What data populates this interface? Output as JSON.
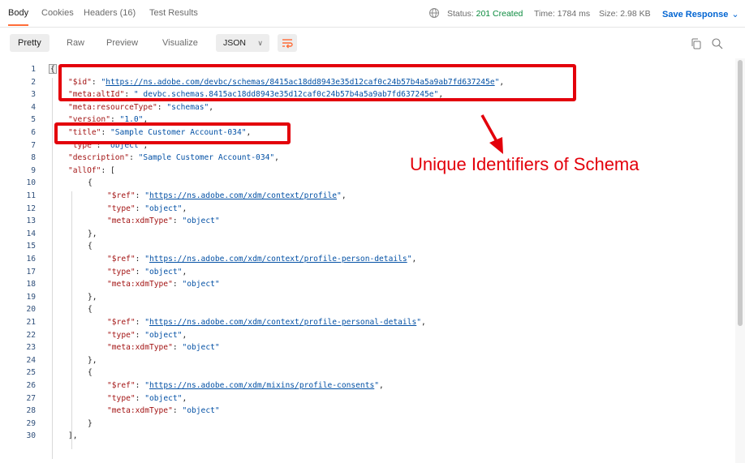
{
  "response_tabs": [
    {
      "label": "Body",
      "active": true
    },
    {
      "label": "Cookies",
      "active": false
    },
    {
      "label": "Headers",
      "count": "(16)",
      "active": false
    },
    {
      "label": "Test Results",
      "active": false
    }
  ],
  "status": {
    "label": "Status:",
    "value": "201 Created"
  },
  "time": {
    "label": "Time:",
    "value": "1784 ms"
  },
  "size": {
    "label": "Size:",
    "value": "2.98 KB"
  },
  "save_response": "Save Response",
  "view_modes": [
    "Pretty",
    "Raw",
    "Preview",
    "Visualize"
  ],
  "active_view_mode": "Pretty",
  "format_select": "JSON",
  "colors": {
    "accent": "#ff6c37",
    "link": "#0265d2",
    "status_ok": "#0b8a3e",
    "annotation": "#e3000b"
  },
  "icons": [
    "globe-icon",
    "chevron-down-icon",
    "wrap-lines-icon",
    "copy-icon",
    "search-icon"
  ],
  "code_lines": [
    {
      "n": "1",
      "indent": 0,
      "tokens": [
        {
          "t": "{",
          "c": "brace"
        }
      ]
    },
    {
      "n": "2",
      "indent": 1,
      "tokens": [
        {
          "t": "\"$id\"",
          "c": "k"
        },
        {
          "t": ": ",
          "c": "p"
        },
        {
          "t": "\"",
          "c": "s"
        },
        {
          "t": "https://ns.adobe.com/devbc/schemas/8415ac18dd8943e35d12caf0c24b57b4a5a9ab7fd637245e",
          "c": "u"
        },
        {
          "t": "\"",
          "c": "s"
        },
        {
          "t": ",",
          "c": "p"
        }
      ]
    },
    {
      "n": "3",
      "indent": 1,
      "tokens": [
        {
          "t": "\"meta:altId\"",
          "c": "k"
        },
        {
          "t": ": ",
          "c": "p"
        },
        {
          "t": "\"_devbc.schemas.8415ac18dd8943e35d12caf0c24b57b4a5a9ab7fd637245e\"",
          "c": "s"
        },
        {
          "t": ",",
          "c": "p"
        }
      ]
    },
    {
      "n": "4",
      "indent": 1,
      "tokens": [
        {
          "t": "\"meta:resourceType\"",
          "c": "k"
        },
        {
          "t": ": ",
          "c": "p"
        },
        {
          "t": "\"schemas\"",
          "c": "s"
        },
        {
          "t": ",",
          "c": "p"
        }
      ]
    },
    {
      "n": "5",
      "indent": 1,
      "tokens": [
        {
          "t": "\"version\"",
          "c": "k"
        },
        {
          "t": ": ",
          "c": "p"
        },
        {
          "t": "\"1.0\"",
          "c": "s"
        },
        {
          "t": ",",
          "c": "p"
        }
      ]
    },
    {
      "n": "6",
      "indent": 1,
      "tokens": [
        {
          "t": "\"title\"",
          "c": "k"
        },
        {
          "t": ": ",
          "c": "p"
        },
        {
          "t": "\"Sample Customer Account-034\"",
          "c": "s"
        },
        {
          "t": ",",
          "c": "p"
        }
      ]
    },
    {
      "n": "7",
      "indent": 1,
      "tokens": [
        {
          "t": "\"type\"",
          "c": "k"
        },
        {
          "t": ": ",
          "c": "p"
        },
        {
          "t": "\"object\"",
          "c": "s"
        },
        {
          "t": ",",
          "c": "p"
        }
      ]
    },
    {
      "n": "8",
      "indent": 1,
      "tokens": [
        {
          "t": "\"description\"",
          "c": "k"
        },
        {
          "t": ": ",
          "c": "p"
        },
        {
          "t": "\"Sample Customer Account-034\"",
          "c": "s"
        },
        {
          "t": ",",
          "c": "p"
        }
      ]
    },
    {
      "n": "9",
      "indent": 1,
      "tokens": [
        {
          "t": "\"allOf\"",
          "c": "k"
        },
        {
          "t": ": [",
          "c": "p"
        }
      ]
    },
    {
      "n": "10",
      "indent": 2,
      "tokens": [
        {
          "t": "{",
          "c": "p"
        }
      ]
    },
    {
      "n": "11",
      "indent": 3,
      "tokens": [
        {
          "t": "\"$ref\"",
          "c": "k"
        },
        {
          "t": ": ",
          "c": "p"
        },
        {
          "t": "\"",
          "c": "s"
        },
        {
          "t": "https://ns.adobe.com/xdm/context/profile",
          "c": "u"
        },
        {
          "t": "\"",
          "c": "s"
        },
        {
          "t": ",",
          "c": "p"
        }
      ]
    },
    {
      "n": "12",
      "indent": 3,
      "tokens": [
        {
          "t": "\"type\"",
          "c": "k"
        },
        {
          "t": ": ",
          "c": "p"
        },
        {
          "t": "\"object\"",
          "c": "s"
        },
        {
          "t": ",",
          "c": "p"
        }
      ]
    },
    {
      "n": "13",
      "indent": 3,
      "tokens": [
        {
          "t": "\"meta:xdmType\"",
          "c": "k"
        },
        {
          "t": ": ",
          "c": "p"
        },
        {
          "t": "\"object\"",
          "c": "s"
        }
      ]
    },
    {
      "n": "14",
      "indent": 2,
      "tokens": [
        {
          "t": "},",
          "c": "p"
        }
      ]
    },
    {
      "n": "15",
      "indent": 2,
      "tokens": [
        {
          "t": "{",
          "c": "p"
        }
      ]
    },
    {
      "n": "16",
      "indent": 3,
      "tokens": [
        {
          "t": "\"$ref\"",
          "c": "k"
        },
        {
          "t": ": ",
          "c": "p"
        },
        {
          "t": "\"",
          "c": "s"
        },
        {
          "t": "https://ns.adobe.com/xdm/context/profile-person-details",
          "c": "u"
        },
        {
          "t": "\"",
          "c": "s"
        },
        {
          "t": ",",
          "c": "p"
        }
      ]
    },
    {
      "n": "17",
      "indent": 3,
      "tokens": [
        {
          "t": "\"type\"",
          "c": "k"
        },
        {
          "t": ": ",
          "c": "p"
        },
        {
          "t": "\"object\"",
          "c": "s"
        },
        {
          "t": ",",
          "c": "p"
        }
      ]
    },
    {
      "n": "18",
      "indent": 3,
      "tokens": [
        {
          "t": "\"meta:xdmType\"",
          "c": "k"
        },
        {
          "t": ": ",
          "c": "p"
        },
        {
          "t": "\"object\"",
          "c": "s"
        }
      ]
    },
    {
      "n": "19",
      "indent": 2,
      "tokens": [
        {
          "t": "},",
          "c": "p"
        }
      ]
    },
    {
      "n": "20",
      "indent": 2,
      "tokens": [
        {
          "t": "{",
          "c": "p"
        }
      ]
    },
    {
      "n": "21",
      "indent": 3,
      "tokens": [
        {
          "t": "\"$ref\"",
          "c": "k"
        },
        {
          "t": ": ",
          "c": "p"
        },
        {
          "t": "\"",
          "c": "s"
        },
        {
          "t": "https://ns.adobe.com/xdm/context/profile-personal-details",
          "c": "u"
        },
        {
          "t": "\"",
          "c": "s"
        },
        {
          "t": ",",
          "c": "p"
        }
      ]
    },
    {
      "n": "22",
      "indent": 3,
      "tokens": [
        {
          "t": "\"type\"",
          "c": "k"
        },
        {
          "t": ": ",
          "c": "p"
        },
        {
          "t": "\"object\"",
          "c": "s"
        },
        {
          "t": ",",
          "c": "p"
        }
      ]
    },
    {
      "n": "23",
      "indent": 3,
      "tokens": [
        {
          "t": "\"meta:xdmType\"",
          "c": "k"
        },
        {
          "t": ": ",
          "c": "p"
        },
        {
          "t": "\"object\"",
          "c": "s"
        }
      ]
    },
    {
      "n": "24",
      "indent": 2,
      "tokens": [
        {
          "t": "},",
          "c": "p"
        }
      ]
    },
    {
      "n": "25",
      "indent": 2,
      "tokens": [
        {
          "t": "{",
          "c": "p"
        }
      ]
    },
    {
      "n": "26",
      "indent": 3,
      "tokens": [
        {
          "t": "\"$ref\"",
          "c": "k"
        },
        {
          "t": ": ",
          "c": "p"
        },
        {
          "t": "\"",
          "c": "s"
        },
        {
          "t": "https://ns.adobe.com/xdm/mixins/profile-consents",
          "c": "u"
        },
        {
          "t": "\"",
          "c": "s"
        },
        {
          "t": ",",
          "c": "p"
        }
      ]
    },
    {
      "n": "27",
      "indent": 3,
      "tokens": [
        {
          "t": "\"type\"",
          "c": "k"
        },
        {
          "t": ": ",
          "c": "p"
        },
        {
          "t": "\"object\"",
          "c": "s"
        },
        {
          "t": ",",
          "c": "p"
        }
      ]
    },
    {
      "n": "28",
      "indent": 3,
      "tokens": [
        {
          "t": "\"meta:xdmType\"",
          "c": "k"
        },
        {
          "t": ": ",
          "c": "p"
        },
        {
          "t": "\"object\"",
          "c": "s"
        }
      ]
    },
    {
      "n": "29",
      "indent": 2,
      "tokens": [
        {
          "t": "}",
          "c": "p"
        }
      ]
    },
    {
      "n": "30",
      "indent": 1,
      "tokens": [
        {
          "t": "],",
          "c": "p"
        }
      ]
    }
  ],
  "annotation": {
    "text": "Unique Identifiers of Schema"
  }
}
